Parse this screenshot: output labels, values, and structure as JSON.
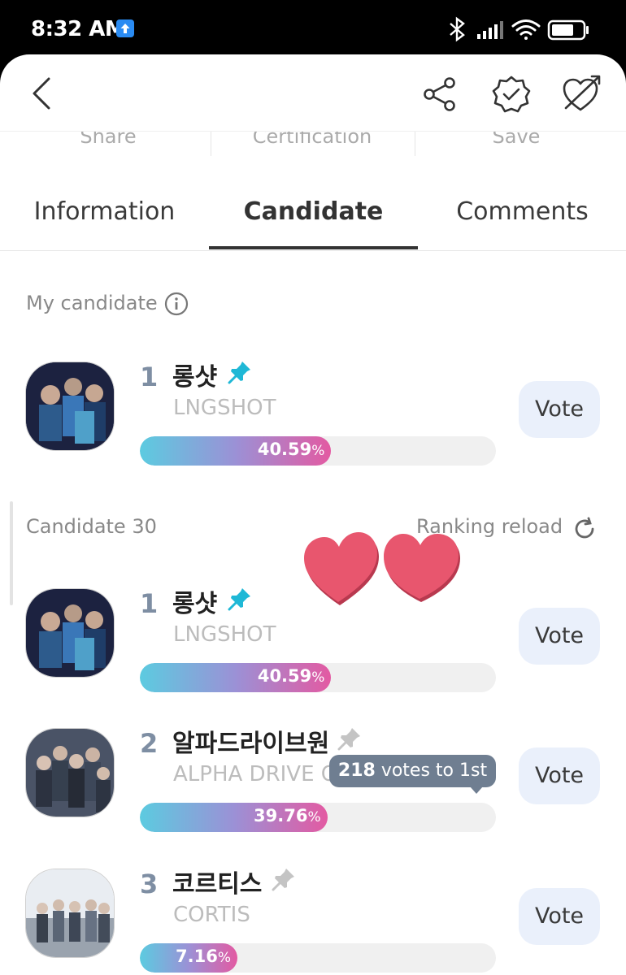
{
  "status_bar": {
    "time": "8:32 AM"
  },
  "header": {
    "actions": [
      {
        "label": "Share"
      },
      {
        "label": "Certification"
      },
      {
        "label": "Save"
      }
    ]
  },
  "tabs": [
    {
      "label": "Information",
      "active": false
    },
    {
      "label": "Candidate",
      "active": true
    },
    {
      "label": "Comments",
      "active": false
    }
  ],
  "my_candidate": {
    "label": "My candidate",
    "rank": "1",
    "name": "롱샷",
    "name_en": "LNGSHOT",
    "percent_value": "40.59",
    "percent_sign": "%",
    "percent_fraction": 0.4059,
    "pinned": true,
    "vote_label": "Vote"
  },
  "candidates_section": {
    "label": "Candidate 30",
    "reload_label": "Ranking reload"
  },
  "candidates": [
    {
      "rank": "1",
      "name": "롱샷",
      "name_en": "LNGSHOT",
      "percent_value": "40.59",
      "percent_sign": "%",
      "percent_fraction": 0.4059,
      "pinned": true,
      "vote_label": "Vote"
    },
    {
      "rank": "2",
      "name": "알파드라이브원",
      "name_en": "ALPHA DRIVE ONE",
      "percent_value": "39.76",
      "percent_sign": "%",
      "percent_fraction": 0.3976,
      "pinned": false,
      "vote_label": "Vote"
    },
    {
      "rank": "3",
      "name": "코르티스",
      "name_en": "CORTIS",
      "percent_value": "7.16",
      "percent_sign": "%",
      "percent_fraction": 0.0716,
      "pinned": false,
      "vote_label": "Vote"
    }
  ],
  "tooltip": {
    "votes": "218",
    "text": " votes to 1st"
  },
  "colors": {
    "accent_pin": "#1fb8d6",
    "inactive_pin": "#c4c4c4",
    "bar_start": "#5ccbe0",
    "bar_end": "#e35aa2",
    "vote_button_bg": "#eaf0fb",
    "heart": "#e8566e"
  }
}
